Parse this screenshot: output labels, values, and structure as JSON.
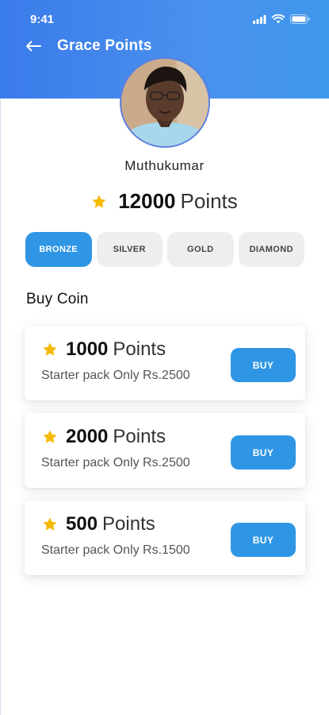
{
  "status": {
    "time": "9:41"
  },
  "header": {
    "title": "Grace Points"
  },
  "profile": {
    "name": "Muthukumar",
    "points_value": "12000",
    "points_unit": "Points"
  },
  "tiers": [
    {
      "label": "BRONZE",
      "active": true
    },
    {
      "label": "SILVER",
      "active": false
    },
    {
      "label": "GOLD",
      "active": false
    },
    {
      "label": "DIAMOND",
      "active": false
    }
  ],
  "section": {
    "title": "Buy Coin"
  },
  "packs": [
    {
      "value": "1000",
      "unit": "Points",
      "desc": "Starter pack Only Rs.2500",
      "button": "BUY"
    },
    {
      "value": "2000",
      "unit": "Points",
      "desc": "Starter pack Only Rs.2500",
      "button": "BUY"
    },
    {
      "value": "500",
      "unit": "Points",
      "desc": "Starter pack Only Rs.1500",
      "button": "BUY"
    }
  ],
  "colors": {
    "primary": "#2f96e6",
    "header_start": "#3a7bea",
    "star": "#f5b900"
  },
  "icons": [
    "back-arrow-icon",
    "signal-icon",
    "wifi-icon",
    "battery-icon",
    "star-icon"
  ]
}
